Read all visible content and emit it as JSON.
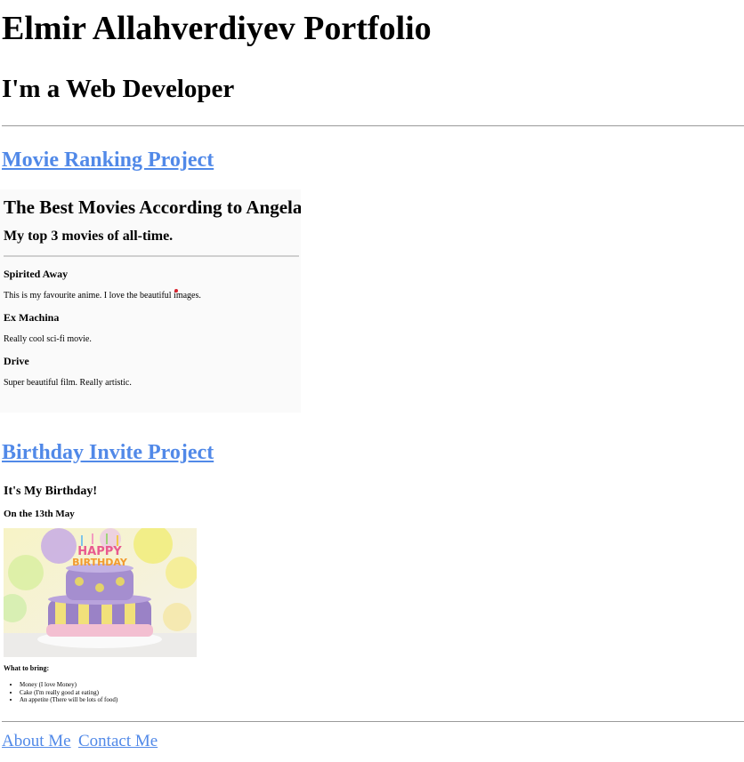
{
  "header": {
    "title": "Elmir Allahverdiyev Portfolio",
    "subtitle": "I'm a Web Developer"
  },
  "projects": [
    {
      "link_label": "Movie Ranking Project",
      "preview": {
        "title": "The Best Movies According to Angela",
        "subtitle": "My top 3 movies of all-time.",
        "movies": [
          {
            "name": "Spirited Away",
            "description": "This is my favourite anime. I love the beautiful images."
          },
          {
            "name": "Ex Machina",
            "description": "Really cool sci-fi movie."
          },
          {
            "name": "Drive",
            "description": "Super beautiful film. Really artistic."
          }
        ]
      }
    },
    {
      "link_label": "Birthday Invite Project",
      "preview": {
        "title": "It's My Birthday!",
        "subtitle": "On the 13th May",
        "image_icon": "birthday-cake-image",
        "bring_heading": "What to bring:",
        "items": [
          "Money (I love Money)",
          "Cake (I'm really good at eating)",
          "An appetite (There will be lots of food)"
        ]
      }
    }
  ],
  "footer": {
    "links": [
      "About Me",
      "Contact Me"
    ]
  },
  "colors": {
    "link": "#5189e8",
    "divider": "#9a9a9a"
  }
}
